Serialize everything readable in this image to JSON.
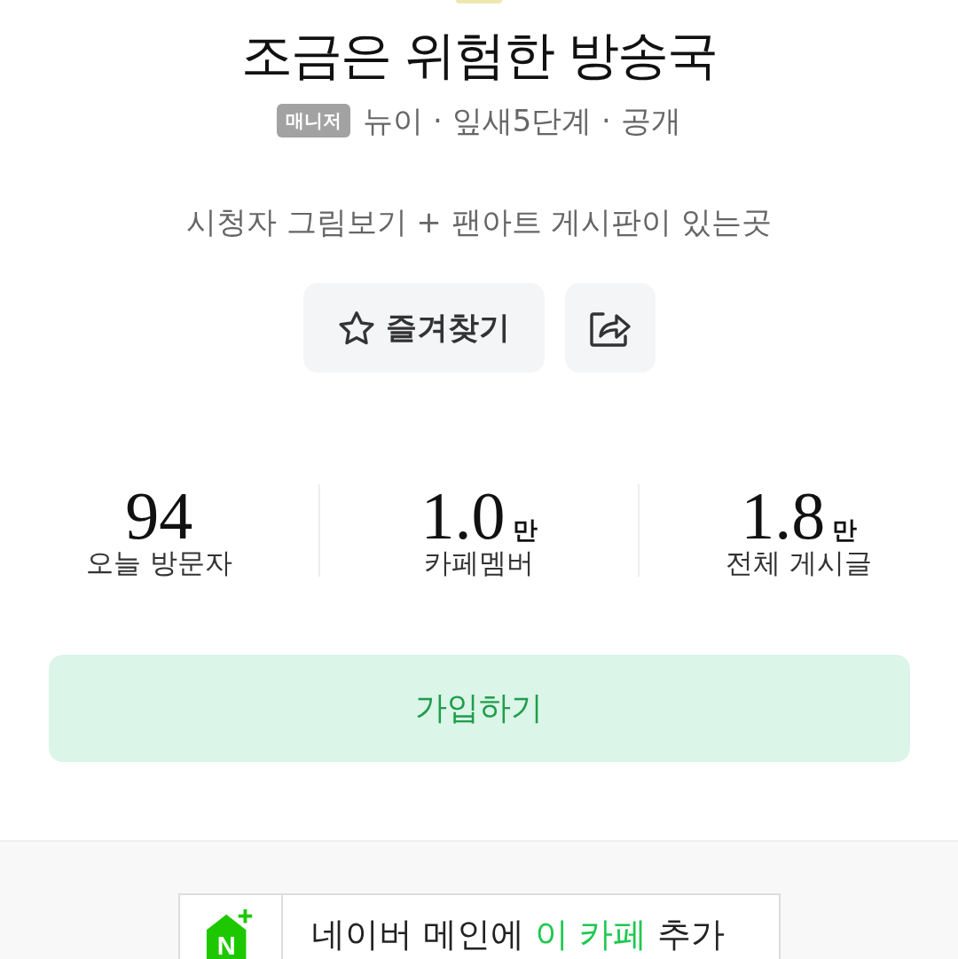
{
  "cafe": {
    "title": "조금은 위험한 방송국",
    "role_badge": "매니저",
    "meta": "뉴이 · 잎새5단계 · 공개",
    "description": "시청자 그림보기 + 팬아트 게시판이 있는곳"
  },
  "actions": {
    "favorite": {
      "label": "즐겨찾기",
      "favorited": false
    }
  },
  "stats": [
    {
      "value": "94",
      "label": "오늘 방문자"
    },
    {
      "value": "1.0",
      "unit": "만",
      "label": "카페멤버"
    },
    {
      "value": "1.8",
      "unit": "만",
      "label": "전체 게시글"
    }
  ],
  "join_button": {
    "label": "가입하기"
  },
  "promo": {
    "logo_letter": "N",
    "segments": [
      {
        "text": "네이버 메인에",
        "highlight": false
      },
      {
        "text": "이 카페",
        "highlight": true
      },
      {
        "text": "추가",
        "highlight": false
      }
    ]
  }
}
